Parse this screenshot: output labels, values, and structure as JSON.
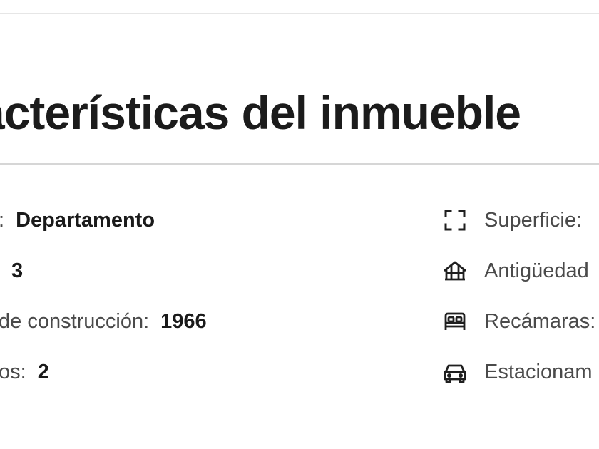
{
  "section": {
    "title": "acterísticas del inmueble"
  },
  "left_features": [
    {
      "label": ":",
      "value": "Departamento"
    },
    {
      "label": "",
      "value": "3"
    },
    {
      "label": "de construcción:",
      "value": "1966"
    },
    {
      "label": "os:",
      "value": "2"
    }
  ],
  "right_features": [
    {
      "icon": "area-icon",
      "label": "Superficie:"
    },
    {
      "icon": "building-age-icon",
      "label": "Antigüedad"
    },
    {
      "icon": "bed-icon",
      "label": "Recámaras:"
    },
    {
      "icon": "car-icon",
      "label": "Estacionam"
    }
  ]
}
